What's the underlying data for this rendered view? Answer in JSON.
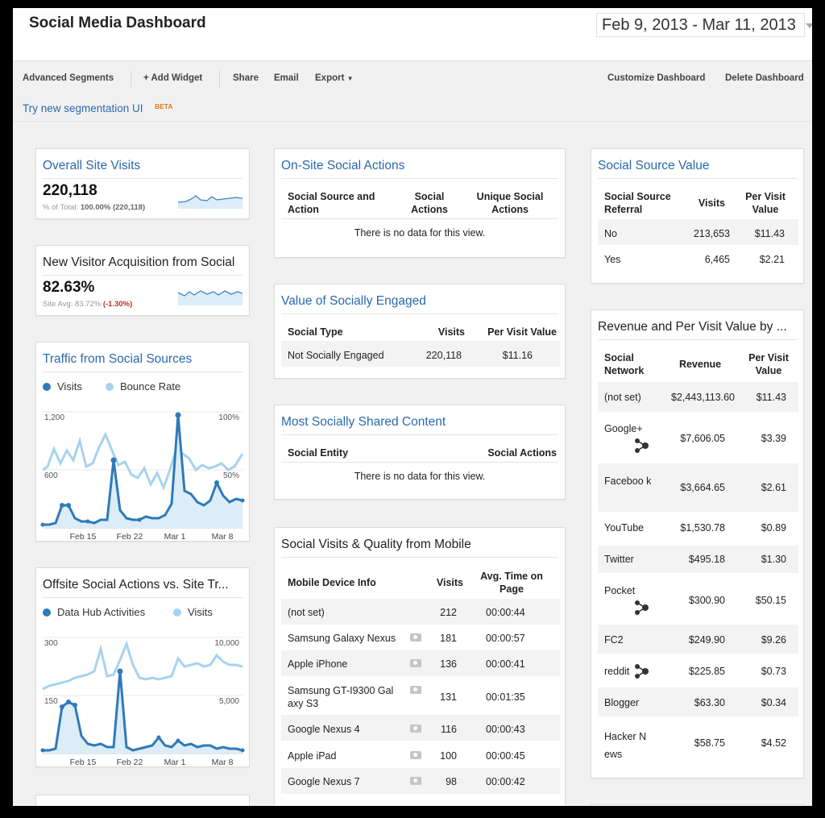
{
  "header": {
    "title": "Social Media Dashboard",
    "date_range": "Feb 9, 2013 - Mar 11, 2013"
  },
  "toolbar": {
    "advanced_segments": "Advanced Segments",
    "add_widget": "+ Add Widget",
    "share": "Share",
    "email": "Email",
    "export": "Export",
    "customize": "Customize Dashboard",
    "delete": "Delete Dashboard"
  },
  "segmentation": {
    "link": "Try new segmentation UI",
    "badge": "BETA"
  },
  "colors": {
    "series_dark": "#2f7ab9",
    "series_light": "#a6d3ee",
    "link": "#2a6aab",
    "negative": "#b8312f"
  },
  "widgets": {
    "overall_visits": {
      "title": "Overall Site Visits",
      "value": "220,118",
      "sub_prefix": "% of Total:",
      "sub_value": "100.00% (220,118)"
    },
    "new_visitor": {
      "title": "New Visitor Acquisition from Social",
      "value": "82.63%",
      "sub_prefix": "Site Avg: 83.72%",
      "sub_delta": "(-1.30%)"
    },
    "traffic_social": {
      "title": "Traffic from Social Sources",
      "legend_a": "Visits",
      "legend_b": "Bounce Rate",
      "y_left_top": "1,200",
      "y_left_mid": "600",
      "y_right_top": "100%",
      "y_right_mid": "50%",
      "x_labels": [
        "Feb 15",
        "Feb 22",
        "Mar 1",
        "Mar 8"
      ]
    },
    "offsite": {
      "title": "Offsite Social Actions vs. Site Tr...",
      "legend_a": "Data Hub Activities",
      "legend_b": "Visits",
      "y_left_top": "300",
      "y_left_mid": "150",
      "y_right_top": "10,000",
      "y_right_mid": "5,000",
      "x_labels": [
        "Feb 15",
        "Feb 22",
        "Mar 1",
        "Mar 8"
      ]
    },
    "onsite": {
      "title": "On-Site Social Actions",
      "headers": [
        "Social Source and Action",
        "Social Actions",
        "Unique Social Actions"
      ],
      "empty": "There is no data for this view."
    },
    "value_engaged": {
      "title": "Value of Socially Engaged",
      "headers": [
        "Social Type",
        "Visits",
        "Per Visit Value"
      ],
      "rows": [
        [
          "Not Socially Engaged",
          "220,118",
          "$11.16"
        ]
      ]
    },
    "most_shared": {
      "title": "Most Socially Shared Content",
      "headers": [
        "Social Entity",
        "Social Actions"
      ],
      "empty": "There is no data for this view."
    },
    "mobile": {
      "title": "Social Visits & Quality from Mobile",
      "headers": [
        "Mobile Device Info",
        "Visits",
        "Avg. Time on Page"
      ],
      "rows": [
        [
          "(not set)",
          "212",
          "00:00:44"
        ],
        [
          "Samsung Galaxy Nexus",
          "181",
          "00:00:57"
        ],
        [
          "Apple iPhone",
          "136",
          "00:00:41"
        ],
        [
          "Samsung GT-I9300 Gal axy S3",
          "131",
          "00:01:35"
        ],
        [
          "Google Nexus 4",
          "116",
          "00:00:43"
        ],
        [
          "Apple iPad",
          "100",
          "00:00:45"
        ],
        [
          "Google Nexus 7",
          "98",
          "00:00:42"
        ]
      ]
    },
    "source_value": {
      "title": "Social Source Value",
      "headers": [
        "Social Source Referral",
        "Visits",
        "Per Visit Value"
      ],
      "rows": [
        [
          "No",
          "213,653",
          "$11.43"
        ],
        [
          "Yes",
          "6,465",
          "$2.21"
        ]
      ]
    },
    "revenue": {
      "title": "Revenue and Per Visit Value by ...",
      "headers": [
        "Social Network",
        "Revenue",
        "Per Visit Value"
      ],
      "rows": [
        [
          "(not set)",
          "$2,443,113.60",
          "$11.43"
        ],
        [
          "Google+",
          "$7,606.05",
          "$3.39"
        ],
        [
          "Faceboo k",
          "$3,664.65",
          "$2.61"
        ],
        [
          "YouTube",
          "$1,530.78",
          "$0.89"
        ],
        [
          "Twitter",
          "$495.18",
          "$1.30"
        ],
        [
          "Pocket",
          "$300.90",
          "$50.15"
        ],
        [
          "FC2",
          "$249.90",
          "$9.26"
        ],
        [
          "reddit",
          "$225.85",
          "$0.73"
        ],
        [
          "Blogger",
          "$63.30",
          "$0.34"
        ],
        [
          "Hacker N ews",
          "$58.75",
          "$4.52"
        ]
      ]
    }
  }
}
